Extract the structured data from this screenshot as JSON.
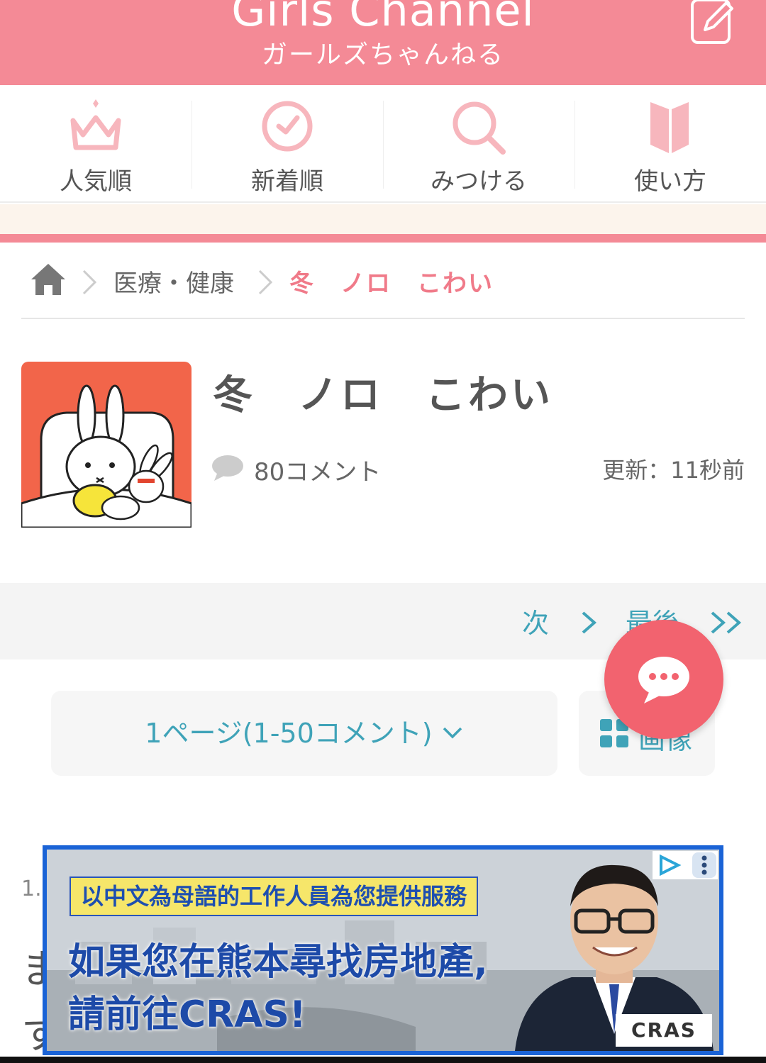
{
  "header": {
    "logo_en": "Girls Channel",
    "logo_ja": "ガールズちゃんねる",
    "post_icon": "edit-icon"
  },
  "nav": {
    "items": [
      {
        "label": "人気順",
        "icon": "crown-icon"
      },
      {
        "label": "新着順",
        "icon": "clock-icon"
      },
      {
        "label": "みつける",
        "icon": "search-icon"
      },
      {
        "label": "使い方",
        "icon": "book-icon"
      }
    ]
  },
  "breadcrumb": {
    "home_icon": "home-icon",
    "category": "医療・健康",
    "current": "冬　ノロ　こわい"
  },
  "topic": {
    "title": "冬　ノロ　こわい",
    "comment_count": "80コメント",
    "updated": "更新：11秒前"
  },
  "pager": {
    "next": "次",
    "last": "最後"
  },
  "page_select": {
    "label": "1ページ(1-50コメント)"
  },
  "image_button": {
    "label": "画像"
  },
  "comment": {
    "number": "1.",
    "line1_start": "ま",
    "line2_start": "す"
  },
  "ad": {
    "banner": "以中文為母語的工作人員為您提供服務",
    "line1": "如果您在熊本尋找房地產,",
    "line2": "請前往CRAS!",
    "logo": "CRAS"
  },
  "colors": {
    "brand_pink": "#f48a96",
    "accent_blue": "#3fa3b8",
    "fab_red": "#f2636f",
    "ad_border": "#1a63d6"
  }
}
